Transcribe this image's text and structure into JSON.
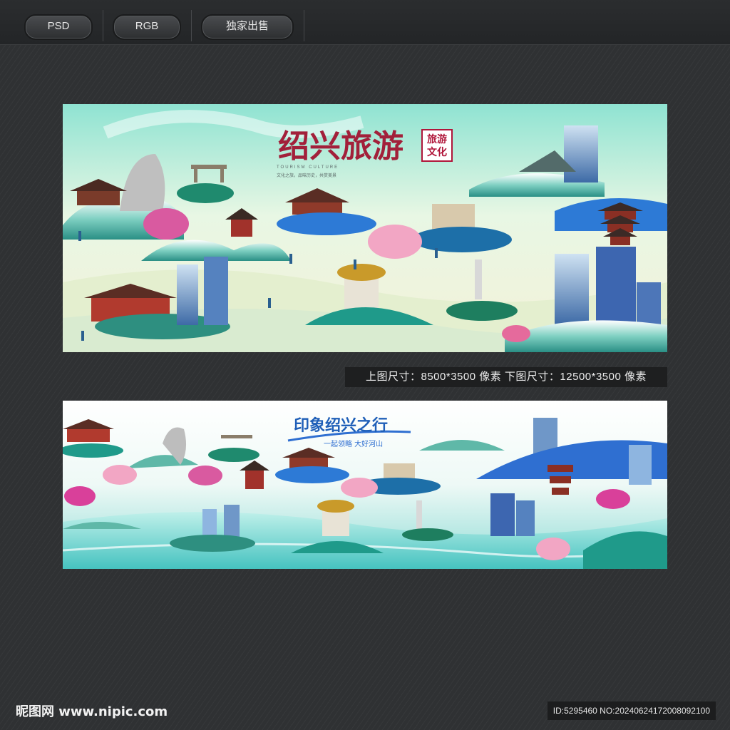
{
  "toolbar": {
    "tags": [
      "PSD",
      "RGB",
      "独家出售"
    ]
  },
  "banner1": {
    "title": "绍兴旅游",
    "seal": [
      "旅游",
      "文化"
    ],
    "subtitle_en": "TOURISM CULTURE",
    "slogan": "文化之旅，品味历史，共赏美景"
  },
  "caption": "上图尺寸：8500*3500 像素   下图尺寸：12500*3500 像素",
  "banner2": {
    "title": "印象绍兴之行",
    "subtitle": "一起领略 大好河山"
  },
  "footer": {
    "site": "昵图网 www.nipic.com",
    "id": "ID:5295460 NO:20240624172008092100"
  },
  "colors": {
    "accent_teal": "#2fa89a",
    "accent_blue": "#2f6fd1",
    "title_red": "#a2203a",
    "pink": "#e87aa8"
  }
}
